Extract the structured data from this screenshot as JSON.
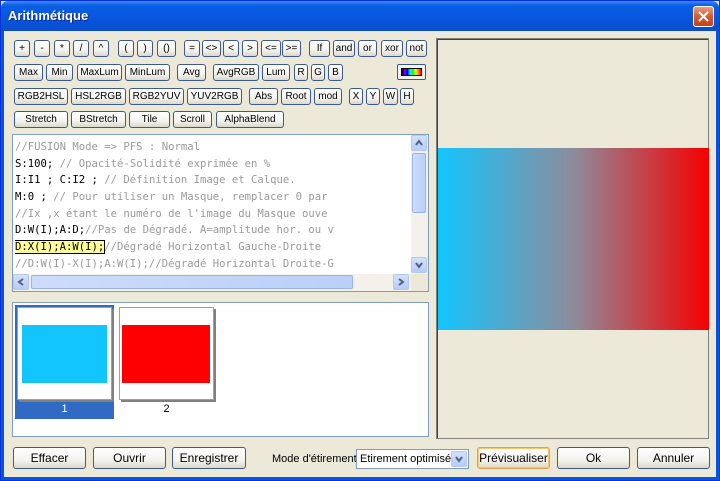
{
  "window": {
    "title": "Arithmétique"
  },
  "operators": {
    "row1": [
      "+",
      "-",
      "*",
      "/",
      "^",
      "(",
      ")",
      "()",
      "=",
      "<>",
      "<",
      ">",
      "<=",
      ">=",
      "If",
      "and",
      "or",
      "xor",
      "not"
    ],
    "row2": [
      "Max",
      "Min",
      "MaxLum",
      "MinLum",
      "Avg",
      "AvgRGB",
      "Lum",
      "R",
      "G",
      "B"
    ],
    "row3": [
      "RGB2HSL",
      "HSL2RGB",
      "RGB2YUV",
      "YUV2RGB",
      "Abs",
      "Root",
      "mod",
      "X",
      "Y",
      "W",
      "H"
    ],
    "row4": [
      "Stretch",
      "BStretch",
      "Tile",
      "Scroll",
      "AlphaBlend"
    ],
    "palette_icon": "color-gradient-icon"
  },
  "editor": {
    "lines": [
      {
        "code": "",
        "comment": "//FUSION Mode => PFS : Normal"
      },
      {
        "code": "S:100;",
        "comment": " // Opacité-Solidité exprimée en %"
      },
      {
        "code": "I:I1 ; C:I2 ;",
        "comment": " // Définition Image et Calque."
      },
      {
        "code": "M:0 ;",
        "comment": " // Pour utiliser un Masque, remplacer 0 par"
      },
      {
        "code": "",
        "comment": "//Ix ,x étant le numéro de l'image du Masque ouve"
      },
      {
        "code": "D:W(I);A:D;",
        "comment": "//Pas de Dégradé. A=amplitude hor. ou v"
      },
      {
        "code": "D:X(I);A:W(I);",
        "comment": "//Dégradé Horizontal Gauche-Droite"
      },
      {
        "code": "",
        "comment": "//D:W(I)-X(I);A:W(I);//Dégradé Horizontal Droite-G"
      }
    ]
  },
  "images": [
    {
      "label": "1",
      "color": "#13c5ff"
    },
    {
      "label": "2",
      "color": "#ff0000"
    }
  ],
  "preview": {
    "left_color": "#13c5ff",
    "right_color": "#f50000"
  },
  "footer": {
    "clear": "Effacer",
    "open": "Ouvrir",
    "save": "Enregistrer",
    "stretch_label": "Mode d'étirement",
    "stretch_value": "Etirement optimisé",
    "preview": "Prévisualiser",
    "ok": "Ok",
    "cancel": "Annuler"
  }
}
